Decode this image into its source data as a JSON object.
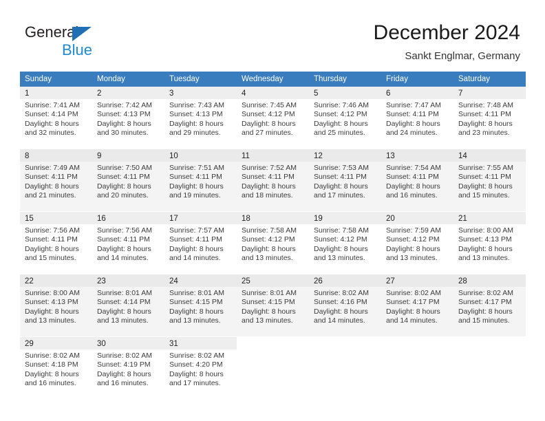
{
  "brand": {
    "name_part1": "General",
    "name_part2": "Blue",
    "triangle_color": "#1f6fb5",
    "blue_color": "#1f8ad6"
  },
  "header": {
    "title": "December 2024",
    "subtitle": "Sankt Englmar, Germany"
  },
  "colors": {
    "header_row_bg": "#3a7dbf",
    "header_row_text": "#ffffff",
    "band_row_bg": "#f4f4f4",
    "daynum_bg": "#eeeeee"
  },
  "weekdays": [
    "Sunday",
    "Monday",
    "Tuesday",
    "Wednesday",
    "Thursday",
    "Friday",
    "Saturday"
  ],
  "weeks": [
    [
      {
        "day": "1",
        "sunrise": "Sunrise: 7:41 AM",
        "sunset": "Sunset: 4:14 PM",
        "daylight1": "Daylight: 8 hours",
        "daylight2": "and 32 minutes."
      },
      {
        "day": "2",
        "sunrise": "Sunrise: 7:42 AM",
        "sunset": "Sunset: 4:13 PM",
        "daylight1": "Daylight: 8 hours",
        "daylight2": "and 30 minutes."
      },
      {
        "day": "3",
        "sunrise": "Sunrise: 7:43 AM",
        "sunset": "Sunset: 4:13 PM",
        "daylight1": "Daylight: 8 hours",
        "daylight2": "and 29 minutes."
      },
      {
        "day": "4",
        "sunrise": "Sunrise: 7:45 AM",
        "sunset": "Sunset: 4:12 PM",
        "daylight1": "Daylight: 8 hours",
        "daylight2": "and 27 minutes."
      },
      {
        "day": "5",
        "sunrise": "Sunrise: 7:46 AM",
        "sunset": "Sunset: 4:12 PM",
        "daylight1": "Daylight: 8 hours",
        "daylight2": "and 25 minutes."
      },
      {
        "day": "6",
        "sunrise": "Sunrise: 7:47 AM",
        "sunset": "Sunset: 4:11 PM",
        "daylight1": "Daylight: 8 hours",
        "daylight2": "and 24 minutes."
      },
      {
        "day": "7",
        "sunrise": "Sunrise: 7:48 AM",
        "sunset": "Sunset: 4:11 PM",
        "daylight1": "Daylight: 8 hours",
        "daylight2": "and 23 minutes."
      }
    ],
    [
      {
        "day": "8",
        "sunrise": "Sunrise: 7:49 AM",
        "sunset": "Sunset: 4:11 PM",
        "daylight1": "Daylight: 8 hours",
        "daylight2": "and 21 minutes."
      },
      {
        "day": "9",
        "sunrise": "Sunrise: 7:50 AM",
        "sunset": "Sunset: 4:11 PM",
        "daylight1": "Daylight: 8 hours",
        "daylight2": "and 20 minutes."
      },
      {
        "day": "10",
        "sunrise": "Sunrise: 7:51 AM",
        "sunset": "Sunset: 4:11 PM",
        "daylight1": "Daylight: 8 hours",
        "daylight2": "and 19 minutes."
      },
      {
        "day": "11",
        "sunrise": "Sunrise: 7:52 AM",
        "sunset": "Sunset: 4:11 PM",
        "daylight1": "Daylight: 8 hours",
        "daylight2": "and 18 minutes."
      },
      {
        "day": "12",
        "sunrise": "Sunrise: 7:53 AM",
        "sunset": "Sunset: 4:11 PM",
        "daylight1": "Daylight: 8 hours",
        "daylight2": "and 17 minutes."
      },
      {
        "day": "13",
        "sunrise": "Sunrise: 7:54 AM",
        "sunset": "Sunset: 4:11 PM",
        "daylight1": "Daylight: 8 hours",
        "daylight2": "and 16 minutes."
      },
      {
        "day": "14",
        "sunrise": "Sunrise: 7:55 AM",
        "sunset": "Sunset: 4:11 PM",
        "daylight1": "Daylight: 8 hours",
        "daylight2": "and 15 minutes."
      }
    ],
    [
      {
        "day": "15",
        "sunrise": "Sunrise: 7:56 AM",
        "sunset": "Sunset: 4:11 PM",
        "daylight1": "Daylight: 8 hours",
        "daylight2": "and 15 minutes."
      },
      {
        "day": "16",
        "sunrise": "Sunrise: 7:56 AM",
        "sunset": "Sunset: 4:11 PM",
        "daylight1": "Daylight: 8 hours",
        "daylight2": "and 14 minutes."
      },
      {
        "day": "17",
        "sunrise": "Sunrise: 7:57 AM",
        "sunset": "Sunset: 4:11 PM",
        "daylight1": "Daylight: 8 hours",
        "daylight2": "and 14 minutes."
      },
      {
        "day": "18",
        "sunrise": "Sunrise: 7:58 AM",
        "sunset": "Sunset: 4:12 PM",
        "daylight1": "Daylight: 8 hours",
        "daylight2": "and 13 minutes."
      },
      {
        "day": "19",
        "sunrise": "Sunrise: 7:58 AM",
        "sunset": "Sunset: 4:12 PM",
        "daylight1": "Daylight: 8 hours",
        "daylight2": "and 13 minutes."
      },
      {
        "day": "20",
        "sunrise": "Sunrise: 7:59 AM",
        "sunset": "Sunset: 4:12 PM",
        "daylight1": "Daylight: 8 hours",
        "daylight2": "and 13 minutes."
      },
      {
        "day": "21",
        "sunrise": "Sunrise: 8:00 AM",
        "sunset": "Sunset: 4:13 PM",
        "daylight1": "Daylight: 8 hours",
        "daylight2": "and 13 minutes."
      }
    ],
    [
      {
        "day": "22",
        "sunrise": "Sunrise: 8:00 AM",
        "sunset": "Sunset: 4:13 PM",
        "daylight1": "Daylight: 8 hours",
        "daylight2": "and 13 minutes."
      },
      {
        "day": "23",
        "sunrise": "Sunrise: 8:01 AM",
        "sunset": "Sunset: 4:14 PM",
        "daylight1": "Daylight: 8 hours",
        "daylight2": "and 13 minutes."
      },
      {
        "day": "24",
        "sunrise": "Sunrise: 8:01 AM",
        "sunset": "Sunset: 4:15 PM",
        "daylight1": "Daylight: 8 hours",
        "daylight2": "and 13 minutes."
      },
      {
        "day": "25",
        "sunrise": "Sunrise: 8:01 AM",
        "sunset": "Sunset: 4:15 PM",
        "daylight1": "Daylight: 8 hours",
        "daylight2": "and 13 minutes."
      },
      {
        "day": "26",
        "sunrise": "Sunrise: 8:02 AM",
        "sunset": "Sunset: 4:16 PM",
        "daylight1": "Daylight: 8 hours",
        "daylight2": "and 14 minutes."
      },
      {
        "day": "27",
        "sunrise": "Sunrise: 8:02 AM",
        "sunset": "Sunset: 4:17 PM",
        "daylight1": "Daylight: 8 hours",
        "daylight2": "and 14 minutes."
      },
      {
        "day": "28",
        "sunrise": "Sunrise: 8:02 AM",
        "sunset": "Sunset: 4:17 PM",
        "daylight1": "Daylight: 8 hours",
        "daylight2": "and 15 minutes."
      }
    ],
    [
      {
        "day": "29",
        "sunrise": "Sunrise: 8:02 AM",
        "sunset": "Sunset: 4:18 PM",
        "daylight1": "Daylight: 8 hours",
        "daylight2": "and 16 minutes."
      },
      {
        "day": "30",
        "sunrise": "Sunrise: 8:02 AM",
        "sunset": "Sunset: 4:19 PM",
        "daylight1": "Daylight: 8 hours",
        "daylight2": "and 16 minutes."
      },
      {
        "day": "31",
        "sunrise": "Sunrise: 8:02 AM",
        "sunset": "Sunset: 4:20 PM",
        "daylight1": "Daylight: 8 hours",
        "daylight2": "and 17 minutes."
      },
      null,
      null,
      null,
      null
    ]
  ]
}
